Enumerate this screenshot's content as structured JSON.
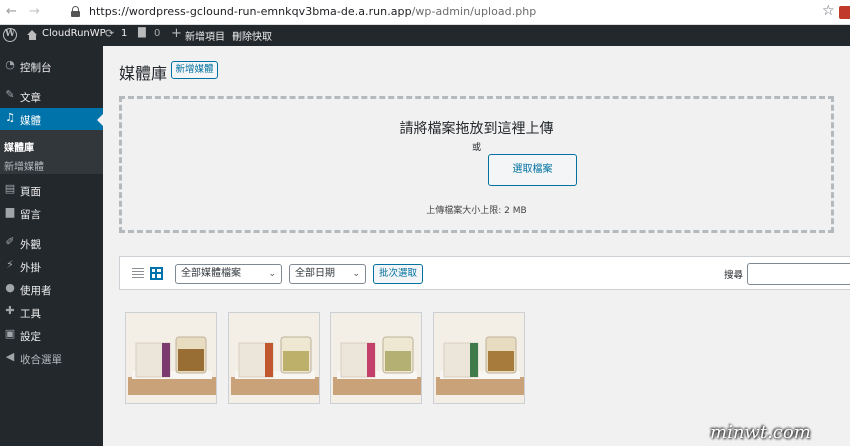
{
  "browser": {
    "url_host": "https://wordpress-gclound-run-emnkqv3bma-de.a.run.app",
    "url_path": "/wp-admin/upload.php"
  },
  "adminbar": {
    "site_name": "CloudRunWP",
    "updates_count": "1",
    "comments_count": "0",
    "new_item": "新增項目",
    "clear_cache": "刪除快取"
  },
  "sidebar": {
    "items": [
      {
        "label": "控制台",
        "icon": "dashboard-icon"
      },
      {
        "label": "文章",
        "icon": "pin-icon"
      },
      {
        "label": "媒體",
        "icon": "media-icon"
      },
      {
        "label": "頁面",
        "icon": "page-icon"
      },
      {
        "label": "留言",
        "icon": "comment-icon"
      },
      {
        "label": "外觀",
        "icon": "brush-icon"
      },
      {
        "label": "外掛",
        "icon": "plugin-icon"
      },
      {
        "label": "使用者",
        "icon": "user-icon"
      },
      {
        "label": "工具",
        "icon": "wrench-icon"
      },
      {
        "label": "設定",
        "icon": "settings-icon"
      },
      {
        "label": "收合選單",
        "icon": "collapse-icon"
      }
    ],
    "submenu": [
      {
        "label": "媒體庫"
      },
      {
        "label": "新增媒體"
      }
    ]
  },
  "main": {
    "title": "媒體庫",
    "add_new": "新增媒體",
    "upload": {
      "heading": "請將檔案拖放到這裡上傳",
      "or": "或",
      "select_button": "選取檔案",
      "max_size": "上傳檔案大小上限: 2 MB"
    },
    "filters": {
      "type_select": "全部媒體檔案",
      "date_select": "全部日期",
      "bulk_select": "批次選取",
      "search_label": "搜尋"
    },
    "thumbnail_count": 4
  },
  "colors": {
    "admin_dark": "#23282d",
    "accent": "#0073aa",
    "button_border": "#0071a1"
  },
  "watermark": "minwt.com"
}
